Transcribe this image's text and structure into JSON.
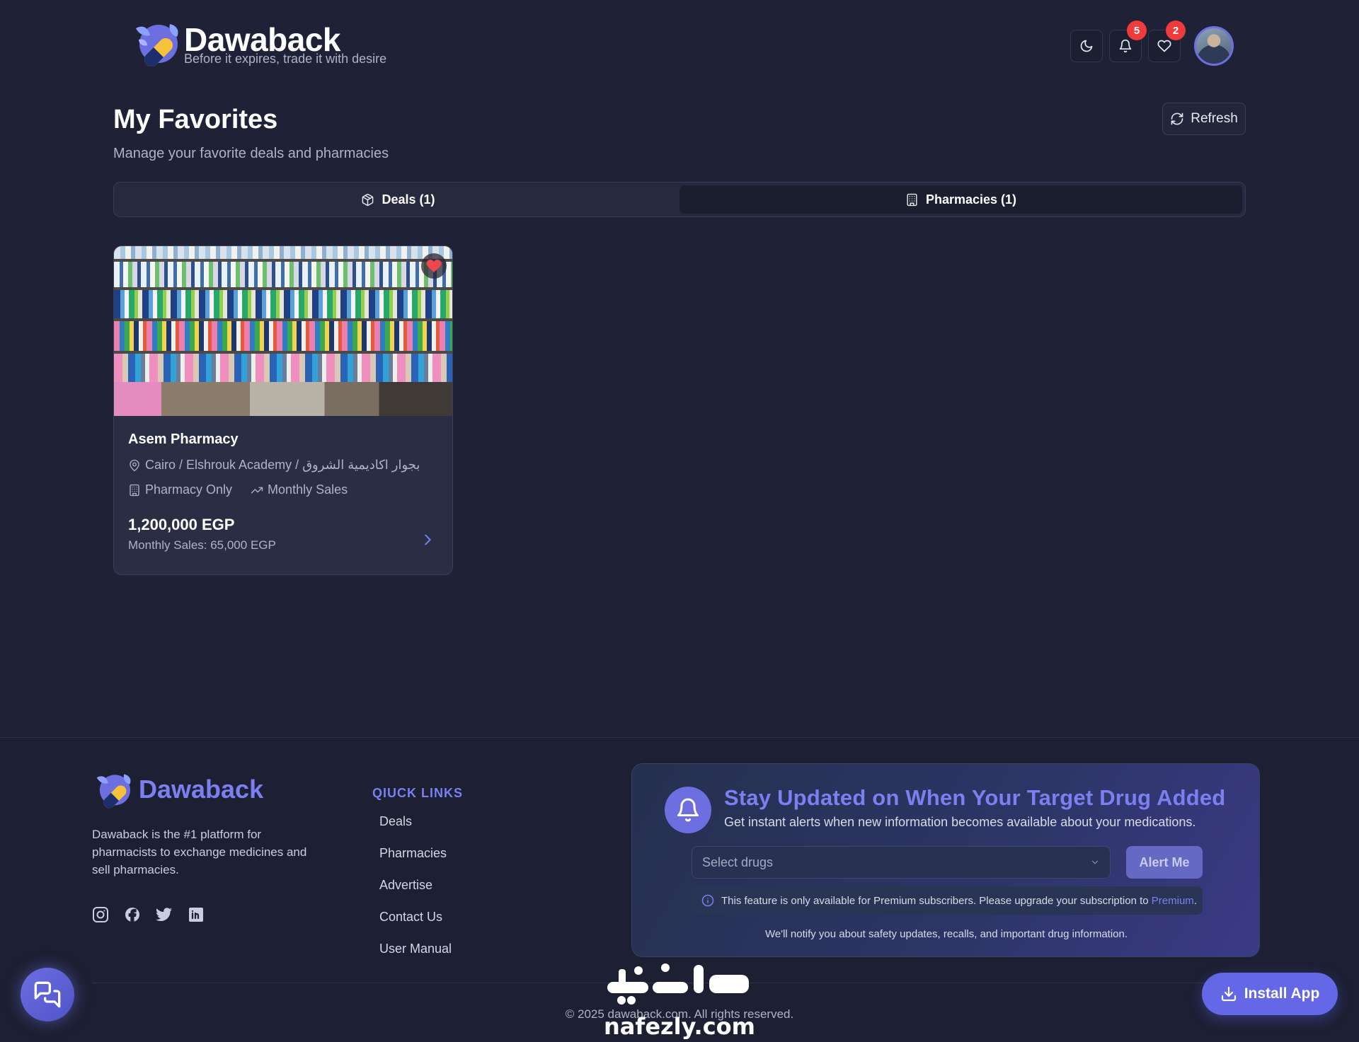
{
  "header": {
    "brand_name": "Dawaback",
    "tagline": "Before it expires, trade it with desire",
    "notifications_count": "5",
    "favorites_count": "2",
    "icons": [
      "moon-icon",
      "bell-icon",
      "heart-icon"
    ]
  },
  "page": {
    "title": "My Favorites",
    "subtitle": "Manage your favorite deals and pharmacies",
    "refresh_label": "Refresh"
  },
  "tabs": [
    {
      "label": "Deals (1)",
      "icon": "package-icon",
      "active": false
    },
    {
      "label": "Pharmacies (1)",
      "icon": "building-icon",
      "active": true
    }
  ],
  "card": {
    "title": "Asem Pharmacy",
    "location": "Cairo / Elshrouk Academy / بجوار اكاديمية الشروق",
    "type": "Pharmacy Only",
    "sales_type": "Monthly Sales",
    "price": "1,200,000 EGP",
    "monthly_sales": "Monthly Sales: 65,000 EGP",
    "favorited": true
  },
  "footer": {
    "brand_name": "Dawaback",
    "description": "Dawaback is the #1 platform for pharmacists to exchange medicines and sell pharmacies.",
    "social": [
      "instagram-icon",
      "facebook-icon",
      "twitter-icon",
      "linkedin-icon"
    ],
    "quick_links_title": "QIUCK LINKS",
    "quick_links": [
      "Deals",
      "Pharmacies",
      "Advertise",
      "Contact Us",
      "User Manual"
    ],
    "alert": {
      "title": "Stay Updated on When Your Target Drug Added",
      "subtitle": "Get instant alerts when new information becomes available about your medications.",
      "select_placeholder": "Select drugs",
      "button_label": "Alert Me",
      "note_prefix": "This feature is only available for Premium subscribers. Please upgrade your subscription to",
      "note_link": "Premium",
      "note_suffix": ".",
      "footnote": "We'll notify you about safety updates, recalls, and important drug information."
    },
    "copyright": "© 2025 dawaback.com. All rights reserved."
  },
  "install_label": "Install App",
  "colors": {
    "background": "#1f2236",
    "accent": "#7b7ff0",
    "badge": "#ef3b3b",
    "heart": "#f0454d"
  }
}
